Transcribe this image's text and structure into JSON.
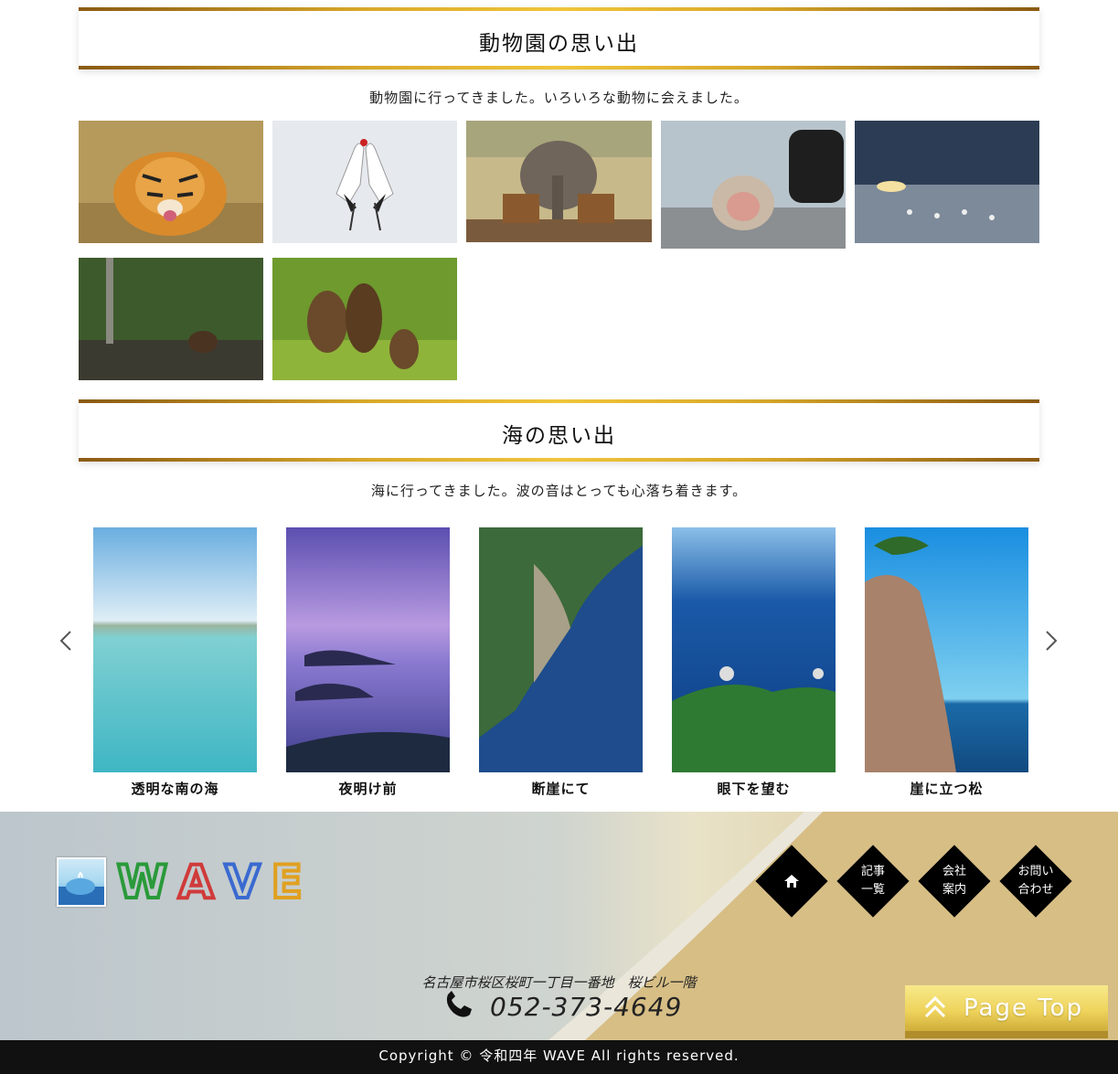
{
  "zoo_section": {
    "title": "動物園の思い出",
    "description": "動物園に行ってきました。いろいろな動物に会えました。",
    "photos": [
      "tiger",
      "cranes",
      "elephant",
      "monkey",
      "swans",
      "bear-in-water",
      "bears"
    ]
  },
  "sea_section": {
    "title": "海の思い出",
    "description": "海に行ってきました。波の音はとっても心落ち着きます。",
    "slides": [
      {
        "caption": "透明な南の海"
      },
      {
        "caption": "夜明け前"
      },
      {
        "caption": "断崖にて"
      },
      {
        "caption": "眼下を望む"
      },
      {
        "caption": "崖に立つ松"
      }
    ],
    "prev_icon": "chevron-left-icon",
    "next_icon": "chevron-right-icon"
  },
  "footer": {
    "logo_letters": [
      "W",
      "A",
      "V",
      "E"
    ],
    "nav": [
      {
        "label": "",
        "icon": "home-icon"
      },
      {
        "label": "記事\n一覧"
      },
      {
        "label": "会社\n案内"
      },
      {
        "label": "お問い\n合わせ"
      }
    ],
    "address": "名古屋市桜区桜町一丁目一番地　桜ビル一階",
    "phone": "052-373-4649",
    "page_top": "Page Top"
  },
  "copyright": "Copyright © 令和四年 WAVE All rights reserved.",
  "colors": {
    "gold_bar": "#d9a92a",
    "footer_bar": "#111111",
    "page_top": "#efd45d"
  }
}
